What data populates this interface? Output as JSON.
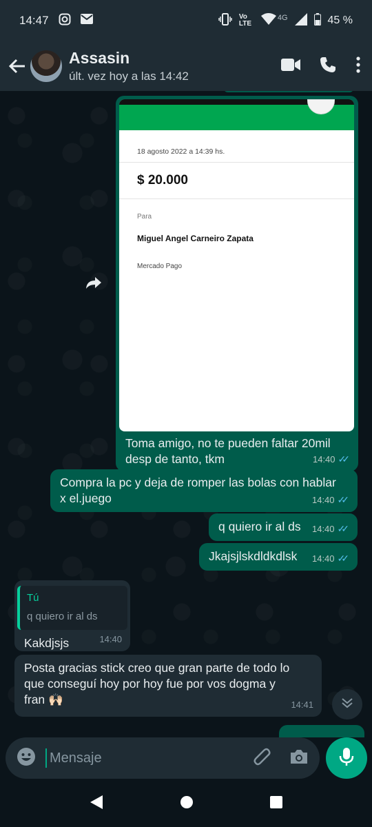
{
  "status_bar": {
    "time": "14:47",
    "network": "4G",
    "volte": "Vo LTE",
    "battery": "45 %"
  },
  "header": {
    "contact_name": "Assasin",
    "contact_status": "últ. vez hoy a las 14:42"
  },
  "messages": {
    "image_msg": {
      "receipt_date": "18 agosto 2022 a 14:39 hs.",
      "receipt_amount": "$ 20.000",
      "receipt_para": "Para",
      "receipt_name": "Miguel Angel Carneiro Zapata",
      "receipt_provider": "Mercado Pago",
      "caption": "Toma amigo, no te pueden faltar 20mil desp de tanto, tkm",
      "time": "14:40"
    },
    "m2": {
      "text": "Compra la pc y deja de romper las bolas con hablar x el.juego",
      "time": "14:40"
    },
    "m3": {
      "text": "q quiero ir al ds",
      "time": "14:40"
    },
    "m4": {
      "text": "Jkajsjlskdldkdlsk",
      "time": "14:40"
    },
    "m5": {
      "quote_author": "Tú",
      "quote_text": "q quiero ir al ds",
      "text": "Kakdjsjs",
      "time": "14:40"
    },
    "m6": {
      "text": "Posta gracias stick creo que gran parte de todo lo que conseguí hoy por hoy fue por vos dogma y fran 🙌🏻",
      "time": "14:41"
    }
  },
  "composer": {
    "placeholder": "Mensaje"
  },
  "colors": {
    "outgoing_bubble": "#005c4b",
    "incoming_bubble": "#1f2c34",
    "accent": "#00a884",
    "read_ticks": "#53bdeb",
    "background": "#0b141a"
  },
  "icons": [
    "instagram-icon",
    "mail-icon",
    "vibrate-icon",
    "wifi-icon",
    "signal-icon",
    "battery-icon",
    "back-arrow-icon",
    "video-call-icon",
    "phone-icon",
    "more-vert-icon",
    "forward-icon",
    "chevron-down-icon",
    "emoji-icon",
    "attach-icon",
    "camera-icon",
    "mic-icon",
    "nav-back-icon",
    "nav-home-icon",
    "nav-recents-icon"
  ]
}
